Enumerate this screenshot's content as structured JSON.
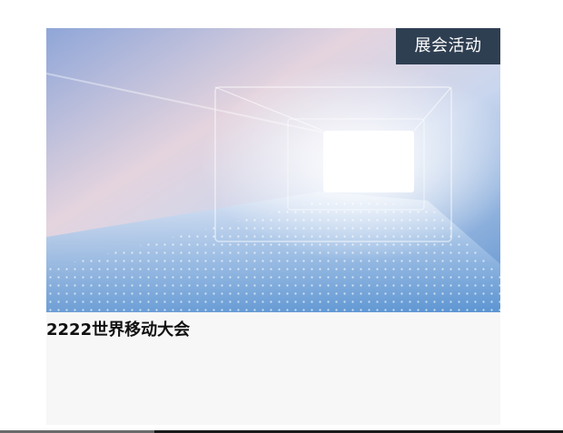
{
  "card": {
    "tag": "展会活动",
    "title": "2222世界移动大会"
  },
  "colors": {
    "tag_bg": "#2f3f52",
    "card_bg": "#f7f7f7",
    "image_sky": "#9db8de",
    "image_glow": "#ffffff"
  }
}
